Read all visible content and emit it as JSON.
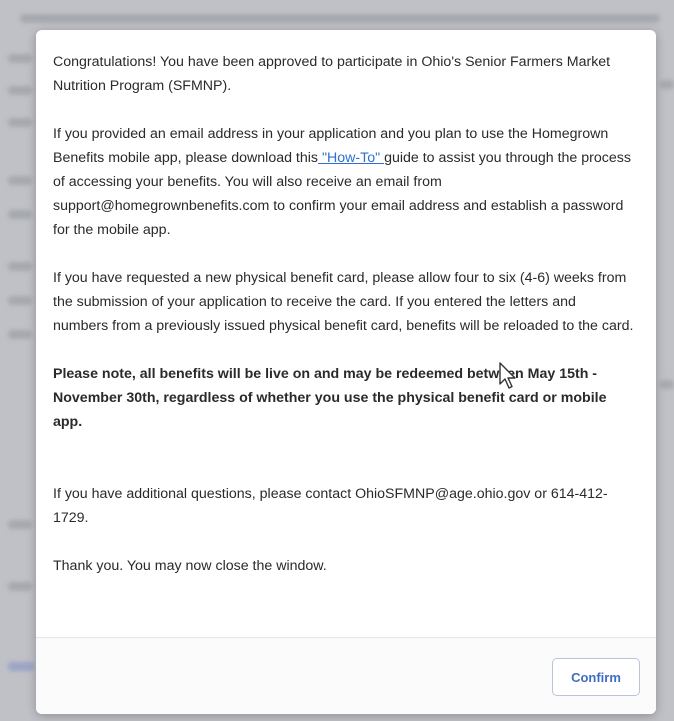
{
  "modal": {
    "paragraph_1": "Congratulations! You have been approved to participate in Ohio's Senior Farmers Market Nutrition Program (SFMNP).",
    "paragraph_2_before_link": "If you provided an email address in your application and you plan to use the Homegrown Benefits mobile app, please download this",
    "paragraph_2_link": " \"How-To\" ",
    "paragraph_2_after_link": "guide to assist you through the process of accessing your benefits. You will also receive an email from support@homegrownbenefits.com to confirm your email address and establish a password for the mobile app.",
    "paragraph_3": "If you have requested a new physical benefit card, please allow four to six (4-6) weeks from the submission of your application to receive the card. If you entered the letters and numbers from a previously issued physical benefit card, benefits will be reloaded to the card.",
    "paragraph_4": "Please note, all benefits will be live on and may be redeemed between May 15th - November 30th, regardless of whether you use the physical benefit card or mobile app.",
    "paragraph_5": "If you have additional questions, please contact OhioSFMNP@age.ohio.gov or 614-412-1729.",
    "paragraph_6": "Thank you. You may now close the window.",
    "confirm_label": "Confirm"
  },
  "colors": {
    "link": "#2d6fd6",
    "confirm_text": "#3f6cc4",
    "backdrop": "#bfc1c6"
  },
  "icons": {
    "cursor": "mouse-pointer-icon"
  }
}
